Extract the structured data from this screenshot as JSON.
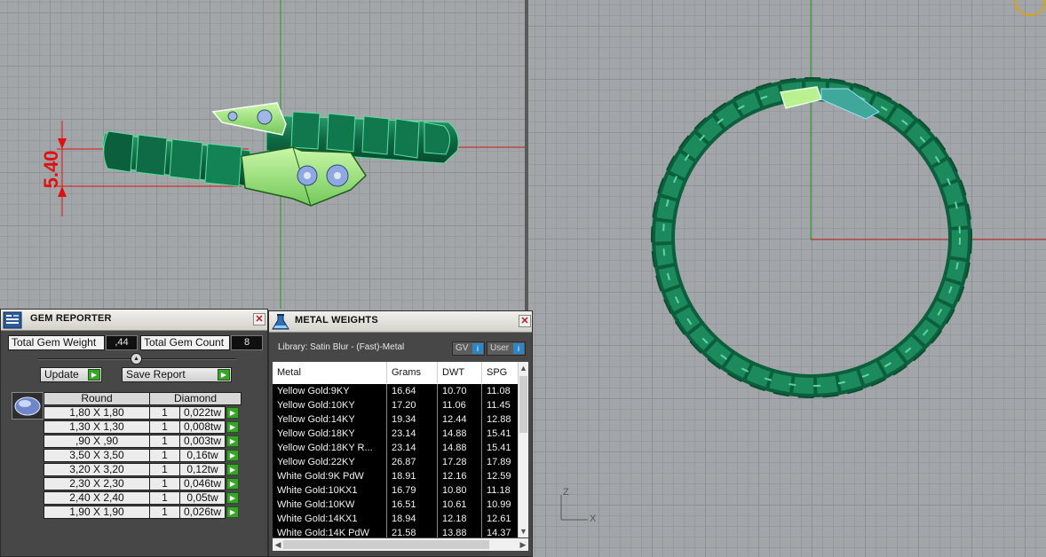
{
  "viewport_left": {
    "dimension_label": "5.40"
  },
  "viewport_right": {
    "axis_z": "Z",
    "axis_x": "X"
  },
  "gem_reporter": {
    "title": "GEM REPORTER",
    "close_label": "✕",
    "total_gem_weight_label": "Total Gem Weight",
    "total_gem_weight_value": ",44",
    "total_gem_count_label": "Total Gem Count",
    "total_gem_count_value": "8",
    "update_label": "Update",
    "save_report_label": "Save Report",
    "table_headers": {
      "shape": "Round",
      "type": "Diamond"
    },
    "rows": [
      {
        "size": "1,80 X 1,80",
        "qty": "1",
        "weight": "0,022tw"
      },
      {
        "size": "1,30 X 1,30",
        "qty": "1",
        "weight": "0,008tw"
      },
      {
        "size": ",90 X ,90",
        "qty": "1",
        "weight": "0,003tw"
      },
      {
        "size": "3,50 X 3,50",
        "qty": "1",
        "weight": "0,16tw"
      },
      {
        "size": "3,20 X 3,20",
        "qty": "1",
        "weight": "0,12tw"
      },
      {
        "size": "2,30 X 2,30",
        "qty": "1",
        "weight": "0,046tw"
      },
      {
        "size": "2,40 X 2,40",
        "qty": "1",
        "weight": "0,05tw"
      },
      {
        "size": "1,90 X 1,90",
        "qty": "1",
        "weight": "0,026tw"
      }
    ]
  },
  "metal_weights": {
    "title": "METAL WEIGHTS",
    "close_label": "✕",
    "library_label": "Library: Satin Blur - (Fast)-Metal",
    "gv_label": "GV",
    "user_label": "User",
    "columns": [
      "Metal",
      "Grams",
      "DWT",
      "SPG"
    ],
    "rows": [
      {
        "metal": "Yellow Gold:9KY",
        "grams": "16.64",
        "dwt": "10.70",
        "spg": "11.08"
      },
      {
        "metal": "Yellow Gold:10KY",
        "grams": "17.20",
        "dwt": "11.06",
        "spg": "11.45"
      },
      {
        "metal": "Yellow Gold:14KY",
        "grams": "19.34",
        "dwt": "12.44",
        "spg": "12.88"
      },
      {
        "metal": "Yellow Gold:18KY",
        "grams": "23.14",
        "dwt": "14.88",
        "spg": "15.41"
      },
      {
        "metal": "Yellow Gold:18KY R...",
        "grams": "23.14",
        "dwt": "14.88",
        "spg": "15.41"
      },
      {
        "metal": "Yellow Gold:22KY",
        "grams": "26.87",
        "dwt": "17.28",
        "spg": "17.89"
      },
      {
        "metal": "White Gold:9K PdW",
        "grams": "18.91",
        "dwt": "12.16",
        "spg": "12.59"
      },
      {
        "metal": "White Gold:10KX1",
        "grams": "16.79",
        "dwt": "10.80",
        "spg": "11.18"
      },
      {
        "metal": "White Gold:10KW",
        "grams": "16.51",
        "dwt": "10.61",
        "spg": "10.99"
      },
      {
        "metal": "White Gold:14KX1",
        "grams": "18.94",
        "dwt": "12.18",
        "spg": "12.61"
      },
      {
        "metal": "White Gold:14K PdW",
        "grams": "21.58",
        "dwt": "13.88",
        "spg": "14.37"
      }
    ]
  }
}
